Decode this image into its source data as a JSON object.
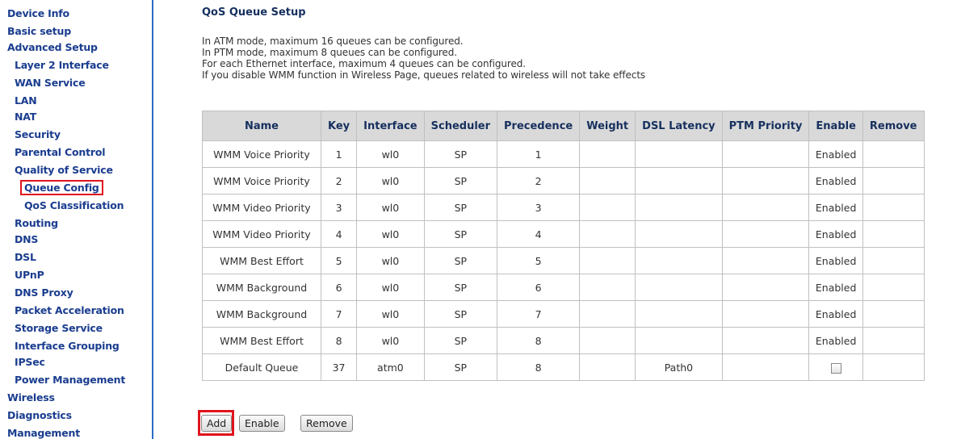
{
  "sidebar": {
    "items": [
      {
        "label": "Device Info"
      },
      {
        "label": "Basic setup"
      },
      {
        "label": "Advanced Setup"
      },
      {
        "label": "Layer 2 Interface"
      },
      {
        "label": "WAN Service"
      },
      {
        "label": "LAN"
      },
      {
        "label": "NAT"
      },
      {
        "label": "Security"
      },
      {
        "label": "Parental Control"
      },
      {
        "label": "Quality of Service"
      },
      {
        "label": "Queue Config"
      },
      {
        "label": "QoS Classification"
      },
      {
        "label": "Routing"
      },
      {
        "label": "DNS"
      },
      {
        "label": "DSL"
      },
      {
        "label": "UPnP"
      },
      {
        "label": "DNS Proxy"
      },
      {
        "label": "Packet Acceleration"
      },
      {
        "label": "Storage Service"
      },
      {
        "label": "Interface Grouping"
      },
      {
        "label": "IPSec"
      },
      {
        "label": "Power Management"
      },
      {
        "label": "Wireless"
      },
      {
        "label": "Diagnostics"
      },
      {
        "label": "Management"
      }
    ],
    "selected": "Queue Config",
    "highlight_color": "#e0141d"
  },
  "main": {
    "title": "QoS Queue Setup",
    "info_lines": [
      "In ATM mode, maximum 16 queues can be configured.",
      "In PTM mode, maximum 8 queues can be configured.",
      "For each Ethernet interface, maximum 4 queues can be configured.",
      "If you disable WMM function in Wireless Page, queues related to wireless will not take effects"
    ],
    "table": {
      "headers": [
        "Name",
        "Key",
        "Interface",
        "Scheduler",
        "Precedence",
        "Weight",
        "DSL Latency",
        "PTM Priority",
        "Enable",
        "Remove"
      ],
      "rows": [
        [
          "WMM Voice Priority",
          "1",
          "wl0",
          "SP",
          "1",
          "",
          "",
          "",
          "Enabled",
          ""
        ],
        [
          "WMM Voice Priority",
          "2",
          "wl0",
          "SP",
          "2",
          "",
          "",
          "",
          "Enabled",
          ""
        ],
        [
          "WMM Video Priority",
          "3",
          "wl0",
          "SP",
          "3",
          "",
          "",
          "",
          "Enabled",
          ""
        ],
        [
          "WMM Video Priority",
          "4",
          "wl0",
          "SP",
          "4",
          "",
          "",
          "",
          "Enabled",
          ""
        ],
        [
          "WMM Best Effort",
          "5",
          "wl0",
          "SP",
          "5",
          "",
          "",
          "",
          "Enabled",
          ""
        ],
        [
          "WMM Background",
          "6",
          "wl0",
          "SP",
          "6",
          "",
          "",
          "",
          "Enabled",
          ""
        ],
        [
          "WMM Background",
          "7",
          "wl0",
          "SP",
          "7",
          "",
          "",
          "",
          "Enabled",
          ""
        ],
        [
          "WMM Best Effort",
          "8",
          "wl0",
          "SP",
          "8",
          "",
          "",
          "",
          "Enabled",
          ""
        ],
        [
          "Default Queue",
          "37",
          "atm0",
          "SP",
          "8",
          "",
          "Path0",
          "",
          "",
          ""
        ]
      ],
      "last_row_enable_checkbox": false
    },
    "buttons": {
      "add": "Add",
      "enable": "Enable",
      "remove": "Remove"
    }
  }
}
